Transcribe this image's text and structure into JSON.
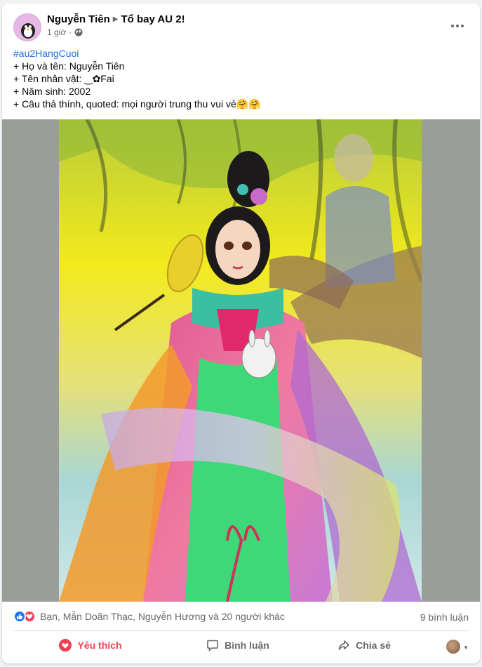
{
  "post": {
    "author": "Nguyễn Tiên",
    "group": "Tổ bay AU 2!",
    "time": "1 giờ",
    "lines": {
      "hashtag": "#au2HangCuoi",
      "line1": "+ Họ và tên: Nguyễn Tiên",
      "line2": "+ Tên nhân vật: ‿✿Fai",
      "line3": "+ Năm sinh: 2002",
      "line4": "+ Câu thả thính, quoted: mọi người trung thu vui vẻ🤗🤗"
    }
  },
  "stats": {
    "reactions_text": "Bạn, Mẫn Doãn Thạc, Nguyễn Hương và 20 người khác",
    "comments_text": "9 bình luận"
  },
  "actions": {
    "like": "Yêu thích",
    "comment": "Bình luận",
    "share": "Chia sẻ"
  },
  "colors": {
    "liked": "#f33e58",
    "link": "#216fdb",
    "like_blue": "#1877f2"
  },
  "icons": {
    "more": "more-options-icon",
    "globe": "globe-icon",
    "like": "like-icon",
    "love": "love-icon",
    "comment": "comment-icon",
    "share": "share-icon"
  }
}
